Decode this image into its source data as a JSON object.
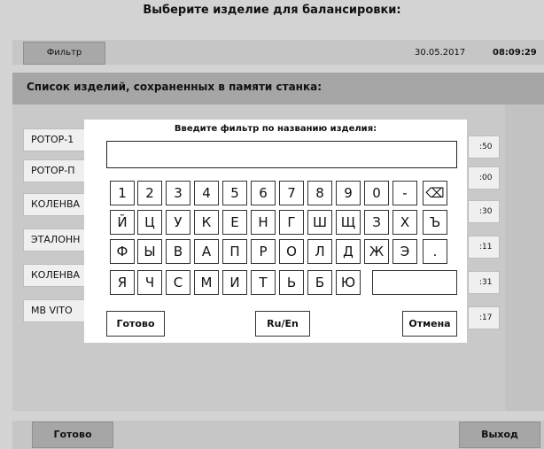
{
  "window_title": "Выберите изделие для балансировки:",
  "topbar": {
    "filter_button": "Фильтр",
    "date": "30.05.2017",
    "time": "08:09:29"
  },
  "list": {
    "header": "Список изделий, сохраненных в памяти станка:",
    "items": [
      {
        "name": "РОТОР-1",
        "time": ":50"
      },
      {
        "name": "РОТОР-П",
        "time": ":00"
      },
      {
        "name": "КОЛЕНВА",
        "time": ":30"
      },
      {
        "name": "ЭТАЛОНН",
        "time": ":11"
      },
      {
        "name": "КОЛЕНВА",
        "time": ":31"
      },
      {
        "name": "MB VITO",
        "time": ":17"
      }
    ]
  },
  "footer": {
    "done": "Готово",
    "exit": "Выход"
  },
  "dialog": {
    "title": "Введите фильтр по названию изделия:",
    "input_value": "",
    "rows": [
      [
        "1",
        "2",
        "3",
        "4",
        "5",
        "6",
        "7",
        "8",
        "9",
        "0",
        "-",
        "⌫"
      ],
      [
        "Й",
        "Ц",
        "У",
        "К",
        "Е",
        "Н",
        "Г",
        "Ш",
        "Щ",
        "З",
        "Х",
        "Ъ"
      ],
      [
        "Ф",
        "Ы",
        "В",
        "А",
        "П",
        "Р",
        "О",
        "Л",
        "Д",
        "Ж",
        "Э",
        "."
      ],
      [
        "Я",
        "Ч",
        "С",
        "М",
        "И",
        "Т",
        "Ь",
        "Б",
        "Ю"
      ]
    ],
    "buttons": {
      "done": "Готово",
      "lang": "Ru/En",
      "cancel": "Отмена"
    }
  }
}
